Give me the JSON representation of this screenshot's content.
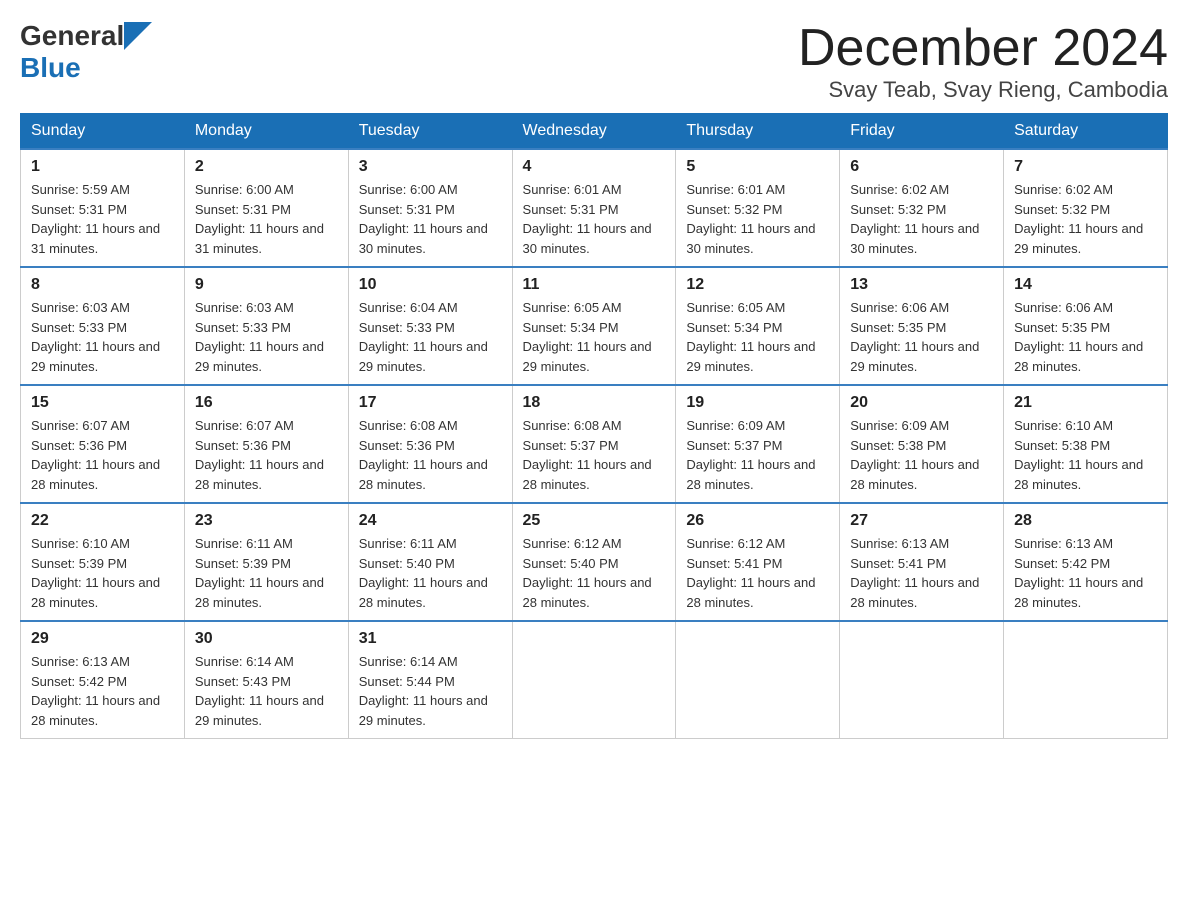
{
  "logo": {
    "general": "General",
    "blue": "Blue",
    "triangle_color": "#1a6fb5"
  },
  "header": {
    "month": "December 2024",
    "location": "Svay Teab, Svay Rieng, Cambodia"
  },
  "weekdays": [
    "Sunday",
    "Monday",
    "Tuesday",
    "Wednesday",
    "Thursday",
    "Friday",
    "Saturday"
  ],
  "weeks": [
    [
      {
        "day": "1",
        "sunrise": "5:59 AM",
        "sunset": "5:31 PM",
        "daylight": "11 hours and 31 minutes."
      },
      {
        "day": "2",
        "sunrise": "6:00 AM",
        "sunset": "5:31 PM",
        "daylight": "11 hours and 31 minutes."
      },
      {
        "day": "3",
        "sunrise": "6:00 AM",
        "sunset": "5:31 PM",
        "daylight": "11 hours and 30 minutes."
      },
      {
        "day": "4",
        "sunrise": "6:01 AM",
        "sunset": "5:31 PM",
        "daylight": "11 hours and 30 minutes."
      },
      {
        "day": "5",
        "sunrise": "6:01 AM",
        "sunset": "5:32 PM",
        "daylight": "11 hours and 30 minutes."
      },
      {
        "day": "6",
        "sunrise": "6:02 AM",
        "sunset": "5:32 PM",
        "daylight": "11 hours and 30 minutes."
      },
      {
        "day": "7",
        "sunrise": "6:02 AM",
        "sunset": "5:32 PM",
        "daylight": "11 hours and 29 minutes."
      }
    ],
    [
      {
        "day": "8",
        "sunrise": "6:03 AM",
        "sunset": "5:33 PM",
        "daylight": "11 hours and 29 minutes."
      },
      {
        "day": "9",
        "sunrise": "6:03 AM",
        "sunset": "5:33 PM",
        "daylight": "11 hours and 29 minutes."
      },
      {
        "day": "10",
        "sunrise": "6:04 AM",
        "sunset": "5:33 PM",
        "daylight": "11 hours and 29 minutes."
      },
      {
        "day": "11",
        "sunrise": "6:05 AM",
        "sunset": "5:34 PM",
        "daylight": "11 hours and 29 minutes."
      },
      {
        "day": "12",
        "sunrise": "6:05 AM",
        "sunset": "5:34 PM",
        "daylight": "11 hours and 29 minutes."
      },
      {
        "day": "13",
        "sunrise": "6:06 AM",
        "sunset": "5:35 PM",
        "daylight": "11 hours and 29 minutes."
      },
      {
        "day": "14",
        "sunrise": "6:06 AM",
        "sunset": "5:35 PM",
        "daylight": "11 hours and 28 minutes."
      }
    ],
    [
      {
        "day": "15",
        "sunrise": "6:07 AM",
        "sunset": "5:36 PM",
        "daylight": "11 hours and 28 minutes."
      },
      {
        "day": "16",
        "sunrise": "6:07 AM",
        "sunset": "5:36 PM",
        "daylight": "11 hours and 28 minutes."
      },
      {
        "day": "17",
        "sunrise": "6:08 AM",
        "sunset": "5:36 PM",
        "daylight": "11 hours and 28 minutes."
      },
      {
        "day": "18",
        "sunrise": "6:08 AM",
        "sunset": "5:37 PM",
        "daylight": "11 hours and 28 minutes."
      },
      {
        "day": "19",
        "sunrise": "6:09 AM",
        "sunset": "5:37 PM",
        "daylight": "11 hours and 28 minutes."
      },
      {
        "day": "20",
        "sunrise": "6:09 AM",
        "sunset": "5:38 PM",
        "daylight": "11 hours and 28 minutes."
      },
      {
        "day": "21",
        "sunrise": "6:10 AM",
        "sunset": "5:38 PM",
        "daylight": "11 hours and 28 minutes."
      }
    ],
    [
      {
        "day": "22",
        "sunrise": "6:10 AM",
        "sunset": "5:39 PM",
        "daylight": "11 hours and 28 minutes."
      },
      {
        "day": "23",
        "sunrise": "6:11 AM",
        "sunset": "5:39 PM",
        "daylight": "11 hours and 28 minutes."
      },
      {
        "day": "24",
        "sunrise": "6:11 AM",
        "sunset": "5:40 PM",
        "daylight": "11 hours and 28 minutes."
      },
      {
        "day": "25",
        "sunrise": "6:12 AM",
        "sunset": "5:40 PM",
        "daylight": "11 hours and 28 minutes."
      },
      {
        "day": "26",
        "sunrise": "6:12 AM",
        "sunset": "5:41 PM",
        "daylight": "11 hours and 28 minutes."
      },
      {
        "day": "27",
        "sunrise": "6:13 AM",
        "sunset": "5:41 PM",
        "daylight": "11 hours and 28 minutes."
      },
      {
        "day": "28",
        "sunrise": "6:13 AM",
        "sunset": "5:42 PM",
        "daylight": "11 hours and 28 minutes."
      }
    ],
    [
      {
        "day": "29",
        "sunrise": "6:13 AM",
        "sunset": "5:42 PM",
        "daylight": "11 hours and 28 minutes."
      },
      {
        "day": "30",
        "sunrise": "6:14 AM",
        "sunset": "5:43 PM",
        "daylight": "11 hours and 29 minutes."
      },
      {
        "day": "31",
        "sunrise": "6:14 AM",
        "sunset": "5:44 PM",
        "daylight": "11 hours and 29 minutes."
      },
      null,
      null,
      null,
      null
    ]
  ]
}
